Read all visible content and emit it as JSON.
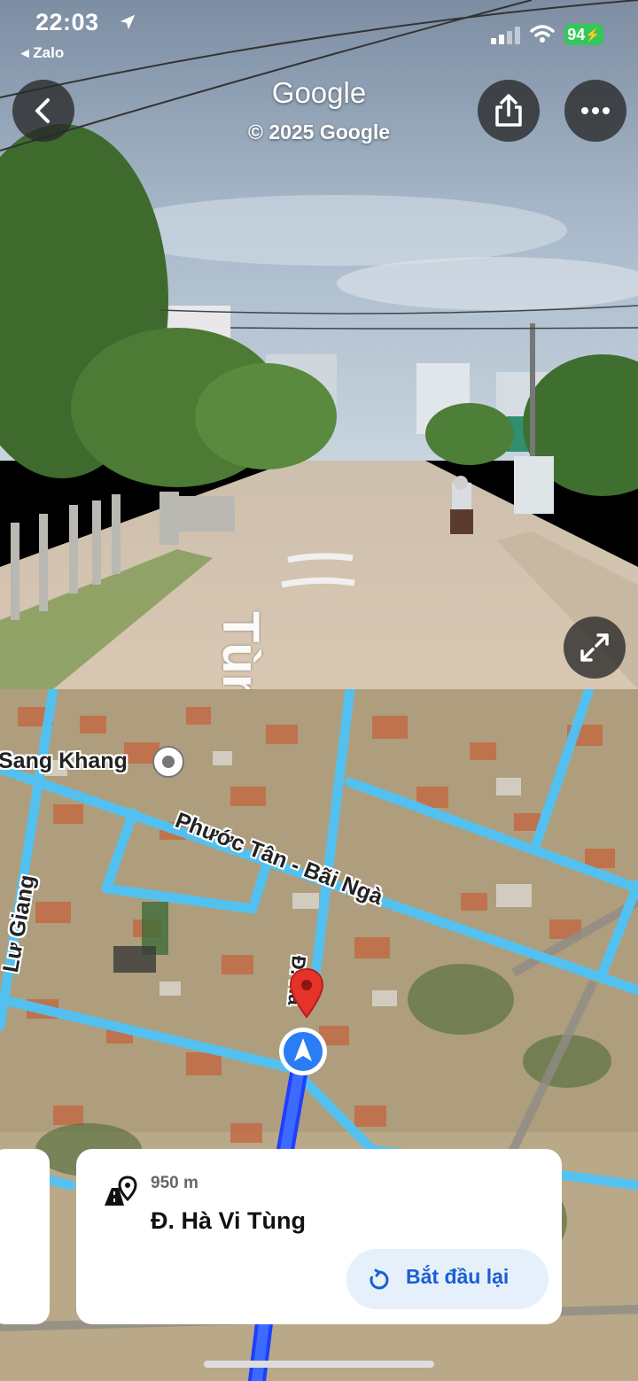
{
  "status_bar": {
    "time": "22:03",
    "back_app": "◂ Zalo",
    "battery": "94"
  },
  "street_view": {
    "title": "Google",
    "copyright": "© 2025 Google",
    "road_label": "Tùng"
  },
  "map": {
    "labels": {
      "sang_khang": "Sang Khang",
      "phuoc_tan": "Phước Tân - Bãi Ngà",
      "lu_giang": "Lư Giang",
      "ha_vi_tung_short": "Đ. Hà"
    }
  },
  "route_card": {
    "distance": "950 m",
    "street": "Đ. Hà Vi Tùng",
    "restart_label": "Bắt đầu lại"
  },
  "icons": [
    "location-arrow-icon",
    "signal-icon",
    "wifi-icon",
    "back-icon",
    "share-icon",
    "more-icon",
    "expand-icon",
    "poi-pin-icon",
    "destination-pin-icon",
    "navigation-arrow-icon",
    "distance-road-icon",
    "restart-icon"
  ],
  "colors": {
    "route_blue": "#1e5bff",
    "road_highlight": "#4fc3f7",
    "button_blue": "#1a5fd2",
    "battery_green": "#34c759"
  }
}
